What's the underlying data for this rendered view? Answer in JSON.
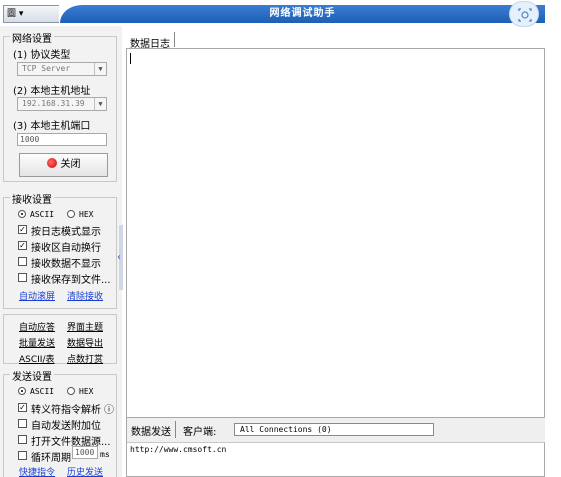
{
  "window": {
    "title": "网络调试助手",
    "menu_label": "圖 ▾"
  },
  "left": {
    "network": {
      "group_title": "网络设置",
      "protocol_label": "(1) 协议类型",
      "protocol_value": "TCP Server",
      "host_label": "(2) 本地主机地址",
      "host_value": "192.168.31.39",
      "port_label": "(3) 本地主机端口",
      "port_value": "1000",
      "close_button": "关闭"
    },
    "receive": {
      "group_title": "接收设置",
      "ascii": "ASCII",
      "hex": "HEX",
      "ascii_selected": true,
      "options": [
        {
          "label": "按日志模式显示",
          "checked": true
        },
        {
          "label": "接收区自动换行",
          "checked": true
        },
        {
          "label": "接收数据不显示",
          "checked": false
        },
        {
          "label": "接收保存到文件...",
          "checked": false
        }
      ],
      "link_autoscroll": "自动滚屏",
      "link_clear": "清除接收"
    },
    "tools": {
      "auto_reply": "自动应答",
      "theme": "界面主题",
      "batch_send": "批量发送",
      "export": "数据导出",
      "ascii_table": "ASCII/表",
      "tally": "点数打赏"
    },
    "send": {
      "group_title": "发送设置",
      "ascii": "ASCII",
      "hex": "HEX",
      "ascii_selected": true,
      "options": [
        {
          "label": "转义符指令解析",
          "checked": true,
          "info": "ⓘ"
        },
        {
          "label": "自动发送附加位",
          "checked": false
        },
        {
          "label": "打开文件数据源...",
          "checked": false
        },
        {
          "label": "循环周期",
          "checked": false,
          "value": "1000",
          "unit": "ms"
        }
      ],
      "link_shortcut": "快捷指令",
      "link_history": "历史发送"
    }
  },
  "right": {
    "log_tab": "数据日志",
    "send_tab": "数据发送",
    "client_label": "客户端:",
    "connections_value": "All Connections (0)",
    "send_text": "http://www.cmsoft.cn"
  },
  "icons": {
    "fullscreen": "fullscreen-icon",
    "close_dot": "red-dot-icon",
    "splitter_arrow": "chevron-left-icon"
  }
}
